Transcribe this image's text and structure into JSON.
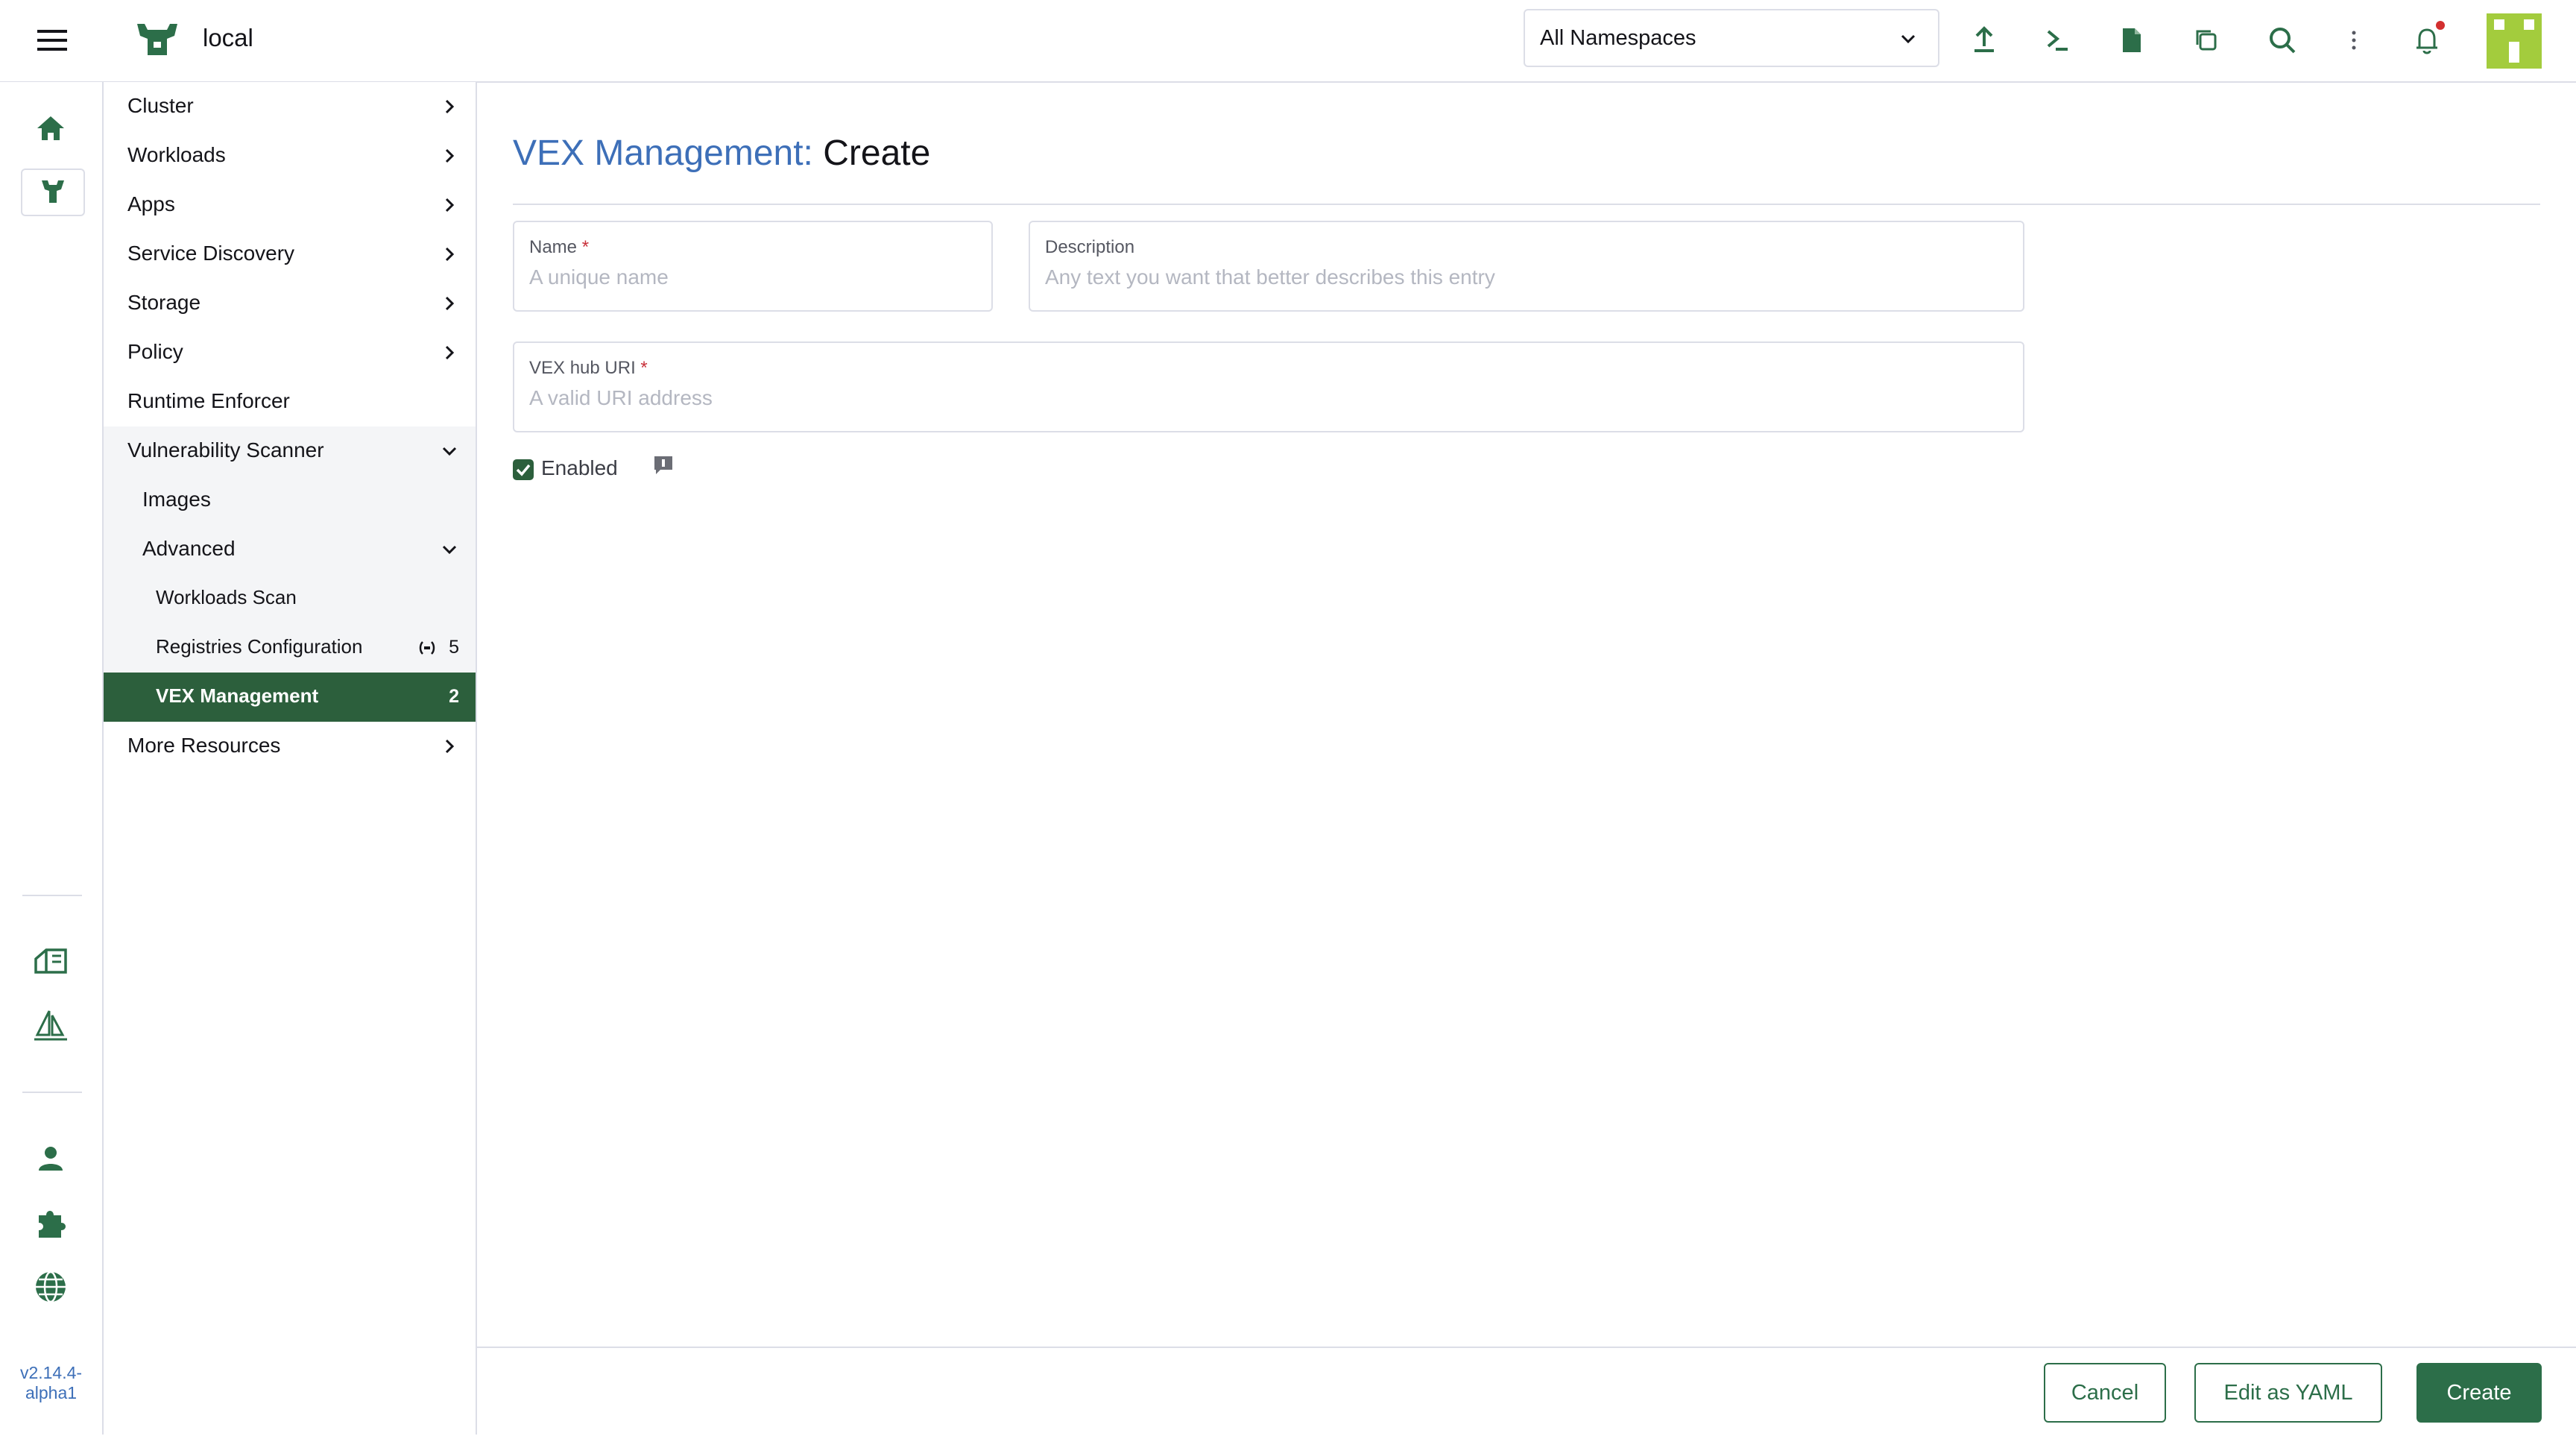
{
  "header": {
    "cluster_name": "local",
    "namespace_select": "All Namespaces",
    "icons": [
      "menu-icon",
      "cluster-logo-icon",
      "import-yaml-icon",
      "kubectl-shell-icon",
      "kubeconfig-file-icon",
      "copy-kubeconfig-icon",
      "search-icon",
      "more-vert-icon",
      "notifications-icon",
      "user-avatar-icon"
    ],
    "notification_dot_color": "#d32f2f"
  },
  "rail": {
    "icons": [
      "home-icon",
      "cluster-icon",
      "fleet-icon",
      "apps-marketplace-icon",
      "users-icon",
      "extensions-icon",
      "global-settings-icon"
    ],
    "version": "v2.14.4-alpha1"
  },
  "sidenav": {
    "items": [
      {
        "label": "Cluster"
      },
      {
        "label": "Workloads"
      },
      {
        "label": "Apps"
      },
      {
        "label": "Service Discovery"
      },
      {
        "label": "Storage"
      },
      {
        "label": "Policy"
      },
      {
        "label": "Runtime Enforcer"
      },
      {
        "label": "Vulnerability Scanner"
      },
      {
        "label": "Images"
      },
      {
        "label": "Advanced"
      },
      {
        "label": "Workloads Scan"
      },
      {
        "label": "Registries Configuration",
        "count": "5"
      },
      {
        "label": "VEX Management",
        "count": "2"
      },
      {
        "label": "More Resources"
      }
    ]
  },
  "main": {
    "title_link": "VEX Management:",
    "title_action": "Create",
    "name_field": {
      "label": "Name",
      "required": "*",
      "placeholder": "A unique name",
      "value": ""
    },
    "description_field": {
      "label": "Description",
      "placeholder": "Any text you want that better describes this entry",
      "value": ""
    },
    "uri_field": {
      "label": "VEX hub URI",
      "required": "*",
      "placeholder": "A valid URI address",
      "value": ""
    },
    "enabled": {
      "label": "Enabled",
      "checked": true
    }
  },
  "footer": {
    "cancel": "Cancel",
    "edit_yaml": "Edit as YAML",
    "create": "Create"
  },
  "colors": {
    "accent": "#2c6e49",
    "active_nav": "#2c5f3c",
    "link_blue": "#3d6fb8",
    "avatar": "#a3cc3d"
  }
}
